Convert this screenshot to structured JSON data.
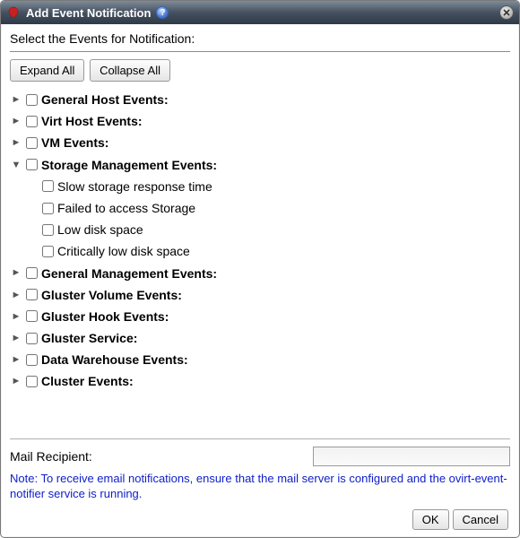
{
  "titlebar": {
    "title": "Add Event Notification",
    "help_glyph": "?",
    "close_glyph": "x"
  },
  "instruction": "Select the Events for Notification:",
  "toolbar": {
    "expand_label": "Expand All",
    "collapse_label": "Collapse All"
  },
  "tree": {
    "categories": [
      {
        "label": "General Host Events:",
        "expanded": false,
        "children": []
      },
      {
        "label": "Virt Host Events:",
        "expanded": false,
        "children": []
      },
      {
        "label": "VM Events:",
        "expanded": false,
        "children": []
      },
      {
        "label": "Storage Management Events:",
        "expanded": true,
        "children": [
          {
            "label": "Slow storage response time"
          },
          {
            "label": "Failed to access Storage"
          },
          {
            "label": "Low disk space"
          },
          {
            "label": "Critically low disk space"
          }
        ]
      },
      {
        "label": "General Management Events:",
        "expanded": false,
        "children": []
      },
      {
        "label": "Gluster Volume Events:",
        "expanded": false,
        "children": []
      },
      {
        "label": "Gluster Hook Events:",
        "expanded": false,
        "children": []
      },
      {
        "label": "Gluster Service:",
        "expanded": false,
        "children": []
      },
      {
        "label": "Data Warehouse Events:",
        "expanded": false,
        "children": []
      },
      {
        "label": "Cluster Events:",
        "expanded": false,
        "children": []
      }
    ]
  },
  "mail": {
    "label": "Mail Recipient:",
    "value": ""
  },
  "note": "Note: To receive email notifications, ensure that the mail server is configured and the ovirt-event-notifier service is running.",
  "buttons": {
    "ok": "OK",
    "cancel": "Cancel"
  }
}
